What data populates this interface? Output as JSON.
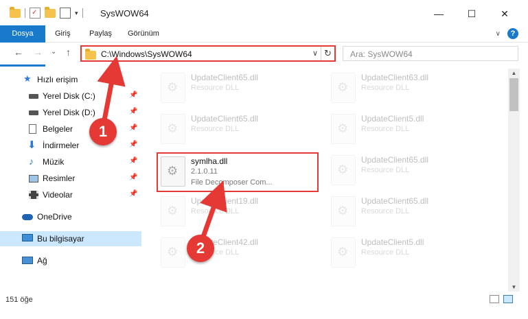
{
  "window": {
    "title": "SysWOW64",
    "minimize_glyph": "—",
    "maximize_glyph": "☐",
    "close_glyph": "✕"
  },
  "ribbon": {
    "tabs": [
      "Dosya",
      "Giriş",
      "Paylaş",
      "Görünüm"
    ],
    "help": "?"
  },
  "nav": {
    "back": "←",
    "forward": "→",
    "recent": "⌄",
    "up": "↑",
    "address": "C:\\Windows\\SysWOW64",
    "refresh": "↻",
    "dropdown": "∨",
    "search_placeholder": "Ara: SysWOW64"
  },
  "sidebar": {
    "items": [
      {
        "label": "Hızlı erişim",
        "icon": "star-icon",
        "pinned": false
      },
      {
        "label": "Yerel Disk (C:)",
        "icon": "drive-icon",
        "pinned": true
      },
      {
        "label": "Yerel Disk (D:)",
        "icon": "drive-icon",
        "pinned": true
      },
      {
        "label": "Belgeler",
        "icon": "document-icon",
        "pinned": true
      },
      {
        "label": "İndirmeler",
        "icon": "download-icon",
        "pinned": true
      },
      {
        "label": "Müzik",
        "icon": "music-icon",
        "pinned": true
      },
      {
        "label": "Resimler",
        "icon": "picture-icon",
        "pinned": true
      },
      {
        "label": "Videolar",
        "icon": "video-icon",
        "pinned": true
      },
      {
        "label": "OneDrive",
        "icon": "cloud-icon",
        "pinned": false
      },
      {
        "label": "Bu bilgisayar",
        "icon": "computer-icon",
        "pinned": false,
        "selected": true
      },
      {
        "label": "Ağ",
        "icon": "network-icon",
        "pinned": false
      }
    ],
    "pin_glyph": "📌"
  },
  "files": [
    {
      "name": "UpdateClient65.dll",
      "line2": "Resource DLL",
      "line3": "",
      "faded": true
    },
    {
      "name": "UpdateClient63.dll",
      "line2": "Resource DLL",
      "line3": "",
      "faded": true
    },
    {
      "name": "UpdateClient65.dll",
      "line2": "Resource DLL",
      "line3": "",
      "faded": true
    },
    {
      "name": "UpdateClient5.dll",
      "line2": "Resource DLL",
      "line3": "",
      "faded": true
    },
    {
      "name": "symlha.dll",
      "line2": "2.1.0.11",
      "line3": "File Decomposer Com...",
      "faded": false,
      "highlight": true
    },
    {
      "name": "UpdateClient65.dll",
      "line2": "Resource DLL",
      "line3": "",
      "faded": true
    },
    {
      "name": "UpdateClient19.dll",
      "line2": "Resource DLL",
      "line3": "",
      "faded": true
    },
    {
      "name": "UpdateClient65.dll",
      "line2": "Resource DLL",
      "line3": "",
      "faded": true
    },
    {
      "name": "UpdateClient42.dll",
      "line2": "Resource DLL",
      "line3": "",
      "faded": true
    },
    {
      "name": "UpdateClient5.dll",
      "line2": "Resource DLL",
      "line3": "",
      "faded": true
    }
  ],
  "status": {
    "count": "151 öğe"
  },
  "markers": [
    "1",
    "2"
  ],
  "colors": {
    "accent": "#1979ca",
    "annotation": "#e53935",
    "selected": "#cce8ff"
  }
}
